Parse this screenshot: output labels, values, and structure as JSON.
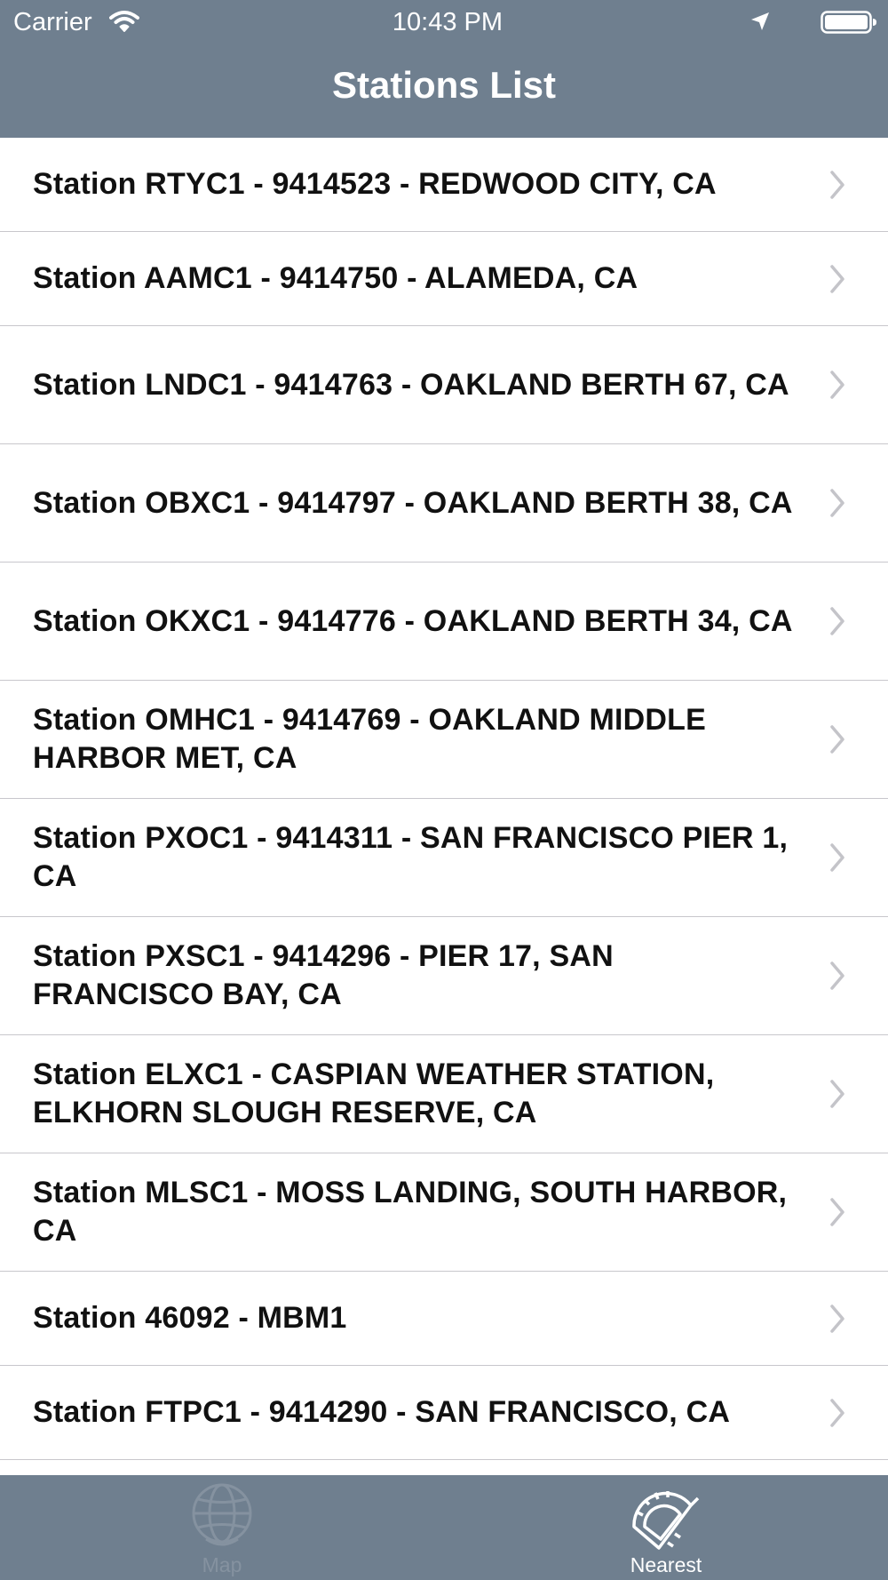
{
  "status_bar": {
    "carrier": "Carrier",
    "time": "10:43 PM"
  },
  "nav": {
    "title": "Stations List"
  },
  "stations": [
    {
      "label": "Station RTYC1 - 9414523 - REDWOOD CITY, CA"
    },
    {
      "label": "Station AAMC1 - 9414750 - ALAMEDA, CA"
    },
    {
      "label": "Station LNDC1 - 9414763 - OAKLAND BERTH 67, CA"
    },
    {
      "label": "Station OBXC1 - 9414797 - OAKLAND BERTH 38, CA"
    },
    {
      "label": "Station OKXC1 - 9414776 - OAKLAND BERTH 34, CA"
    },
    {
      "label": "Station OMHC1 - 9414769 - OAKLAND MIDDLE HARBOR MET, CA"
    },
    {
      "label": "Station PXOC1 - 9414311 - SAN FRANCISCO PIER 1, CA"
    },
    {
      "label": "Station PXSC1 - 9414296 - PIER 17, SAN FRANCISCO BAY, CA"
    },
    {
      "label": "Station ELXC1 - CASPIAN WEATHER STATION, ELKHORN SLOUGH RESERVE, CA"
    },
    {
      "label": "Station MLSC1 - MOSS LANDING, SOUTH HARBOR, CA"
    },
    {
      "label": "Station 46092 - MBM1"
    },
    {
      "label": "Station FTPC1 - 9414290 - SAN FRANCISCO, CA"
    }
  ],
  "tabs": [
    {
      "label": "Map",
      "icon": "globe-icon",
      "selected": false
    },
    {
      "label": "Nearest",
      "icon": "protractor-icon",
      "selected": true
    }
  ],
  "colors": {
    "bar": "#6f7f8f",
    "selected_tab": "#ffffff",
    "unselected_tab": "#8592a0"
  }
}
